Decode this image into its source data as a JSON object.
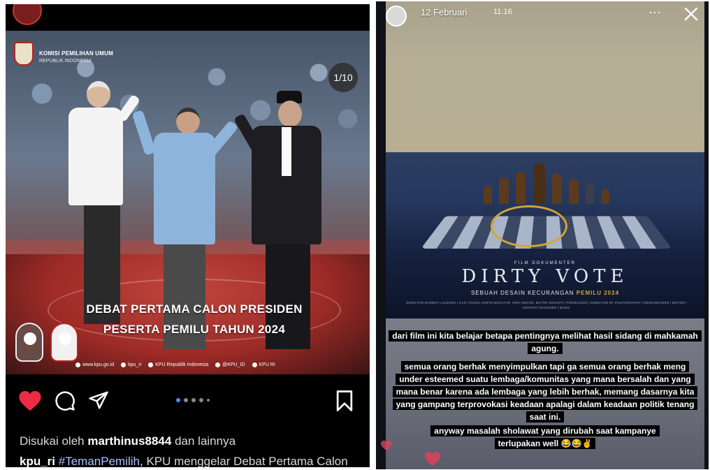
{
  "post": {
    "slide_counter": "1/10",
    "org_name": "KOMISI PEMILIHAN UMUM",
    "org_sub": "REPUBLIK INDONESIA",
    "debate_title_line1": "DEBAT PERTAMA CALON PRESIDEN",
    "debate_title_line2": "PESERTA PEMILU TAHUN 2024",
    "social_links": [
      "www.kpu.go.id",
      "kpu_ri",
      "KPU Republik Indonesia",
      "@KPU_ID",
      "KPU RI"
    ],
    "liked_prefix": "Disukai oleh",
    "liked_user": "marthinus8844",
    "liked_suffix": "dan lainnya",
    "caption_user": "kpu_ri",
    "caption_hashtag": "#TemanPemilih",
    "caption_text": ", KPU menggelar Debat Pertama Calon",
    "carousel_total": 5,
    "carousel_active": 1,
    "like_color": "#ed2b45",
    "hashtag_color": "#a8c4ff"
  },
  "story": {
    "date": "12 Februari",
    "time": "11.16",
    "more_icon": "⋯",
    "film_label": "FILM DOKUMENTER",
    "film_title": "DIRTY VOTE",
    "film_subtitle": "SEBUAH DESAIN KECURANGAN",
    "film_subtitle_accent": "PEMILU 2024",
    "credits": "DIRECTOR DANDHY LAKSONO | CAST ZAINAL ARIFIN MOCHTAR, FERI AMSARI, BIVITRI SUSANTI | PRODUCERS | DIRECTOR OF PHOTOGRAPHY | RESEARCHERS | EDITOR | GRAPHIC DESIGNER | MUSIC",
    "text1": "dari film ini kita belajar betapa pentingnya melihat hasil sidang di mahkamah agung.",
    "text2": "semua orang berhak menyimpulkan tapi ga semua orang berhak meng under esteemed suatu lembaga/komunitas yang mana bersalah dan yang mana benar karena ada lembaga yang lebih berhak, memang dasarnya kita yang gampang terprovokasi keadaan apalagi dalam keadaan politik tenang saat ini.",
    "text3": "anyway masalah sholawat yang dirubah saat kampanye terlupakan well 😂😂✌️",
    "accent_color": "#d8a13a"
  }
}
